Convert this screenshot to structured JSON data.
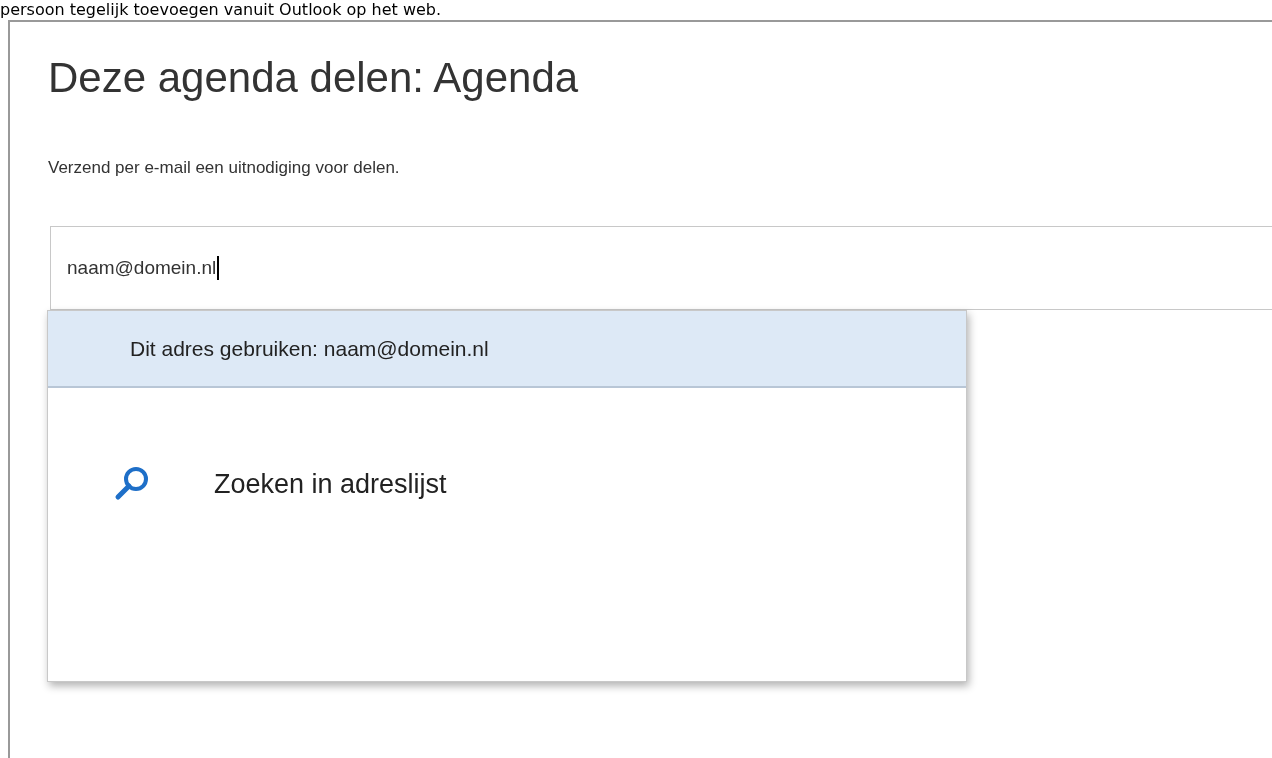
{
  "caption": "persoon tegelijk toevoegen vanuit Outlook op het web.",
  "dialog": {
    "title": "Deze agenda delen: Agenda",
    "instruction": "Verzend per e-mail een uitnodiging voor delen.",
    "recipient_field": {
      "value": "naam@domein.nl"
    }
  },
  "suggestions": [
    {
      "kind": "address",
      "label": "Dit adres gebruiken: naam@domein.nl",
      "selected": true
    },
    {
      "kind": "search",
      "label": "Zoeken in adreslijst",
      "selected": false
    }
  ]
}
